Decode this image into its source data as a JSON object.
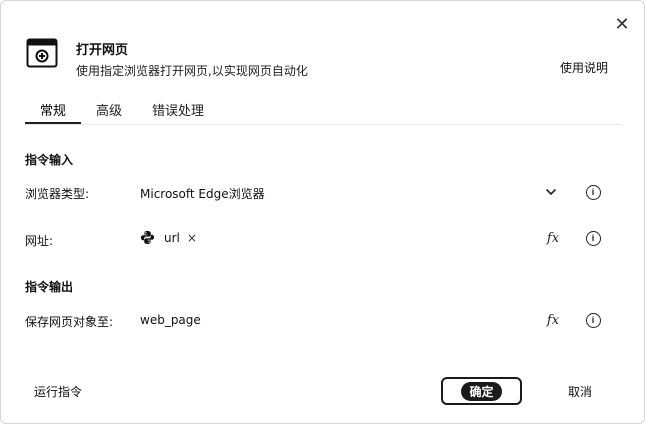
{
  "dialog": {
    "title": "打开网页",
    "subtitle": "使用指定浏览器打开网页,以实现网页自动化",
    "help_link": "使用说明",
    "close_glyph": "✕",
    "app_icon": "browser-window-icon"
  },
  "tabs": [
    {
      "label": "常规",
      "active": true
    },
    {
      "label": "高级",
      "active": false
    },
    {
      "label": "错误处理",
      "active": false
    }
  ],
  "input_section": {
    "title": "指令输入",
    "browser_type": {
      "label": "浏览器类型:",
      "value": "Microsoft Edge浏览器",
      "chevron_icon": "chevron-down-icon",
      "info_icon": "info-icon"
    },
    "url": {
      "label": "网址:",
      "variable_name": "url",
      "variable_icon": "python-icon",
      "remove_glyph": "×",
      "fx_label": "fx",
      "info_icon": "info-icon"
    }
  },
  "output_section": {
    "title": "指令输出",
    "save_to": {
      "label": "保存网页对象至:",
      "value": "web_page",
      "fx_label": "fx",
      "info_icon": "info-icon"
    }
  },
  "footer": {
    "run_label": "运行指令",
    "ok_label": "确定",
    "cancel_label": "取消"
  }
}
